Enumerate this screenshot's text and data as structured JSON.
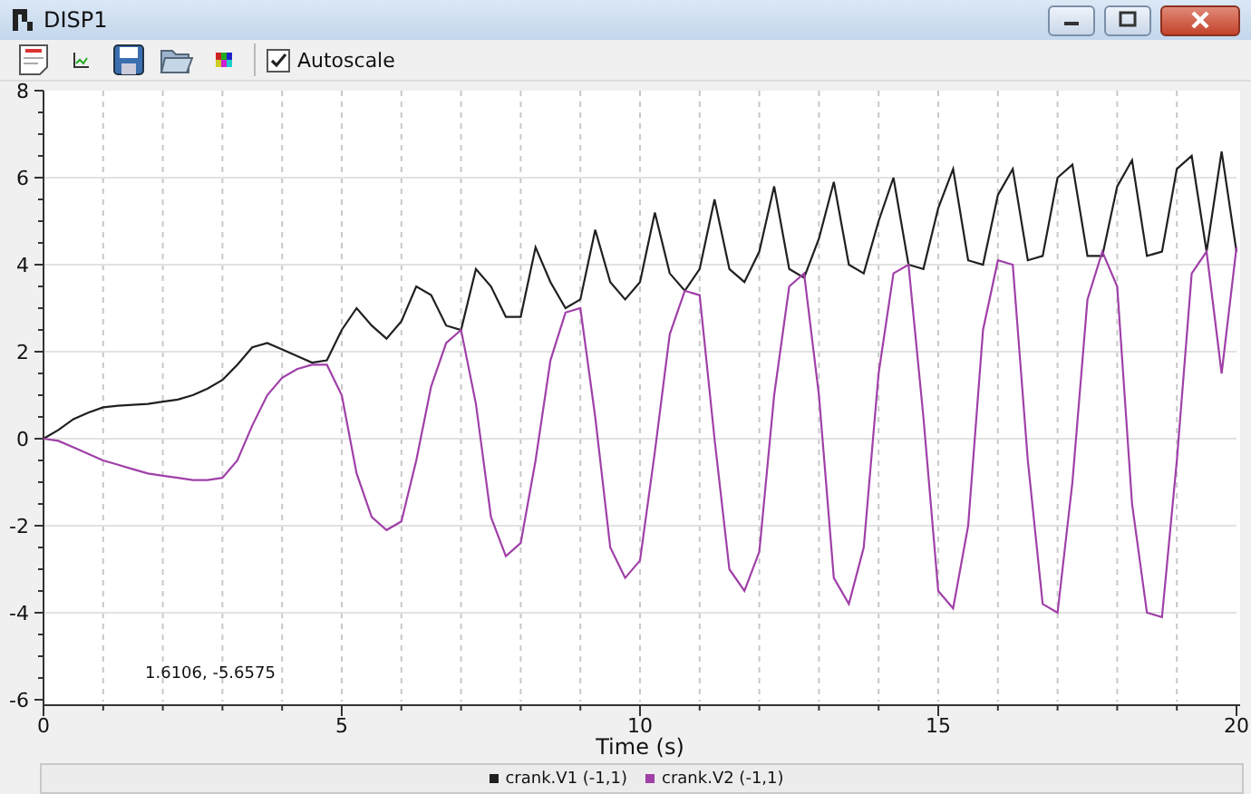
{
  "window": {
    "title": "DISP1"
  },
  "toolbar": {
    "tools": [
      {
        "kind": "note"
      },
      {
        "kind": "axes"
      },
      {
        "kind": "save"
      },
      {
        "kind": "open"
      },
      {
        "kind": "colors"
      }
    ],
    "autoscale": {
      "label": "Autoscale",
      "checked": true
    }
  },
  "plot": {
    "readout": "1.6106, -5.6575",
    "chart_data": {
      "type": "line",
      "grid": true,
      "xlabel": "Time (s)",
      "xlim": [
        0,
        20
      ],
      "ylim": [
        -6,
        8
      ],
      "xticks": [
        0,
        5,
        10,
        15,
        20
      ],
      "yticks": [
        -6,
        -4,
        -2,
        0,
        2,
        4,
        6,
        8
      ],
      "x": [
        0,
        0.25,
        0.5,
        0.75,
        1,
        1.25,
        1.5,
        1.75,
        2,
        2.25,
        2.5,
        2.75,
        3,
        3.25,
        3.5,
        3.75,
        4,
        4.25,
        4.5,
        4.75,
        5,
        5.25,
        5.5,
        5.75,
        6,
        6.25,
        6.5,
        6.75,
        7,
        7.25,
        7.5,
        7.75,
        8,
        8.25,
        8.5,
        8.75,
        9,
        9.25,
        9.5,
        9.75,
        10,
        10.25,
        10.5,
        10.75,
        11,
        11.25,
        11.5,
        11.75,
        12,
        12.25,
        12.5,
        12.75,
        13,
        13.25,
        13.5,
        13.75,
        14,
        14.25,
        14.5,
        14.75,
        15,
        15.25,
        15.5,
        15.75,
        16,
        16.25,
        16.5,
        16.75,
        17,
        17.25,
        17.5,
        17.75,
        18,
        18.25,
        18.5,
        18.75,
        19,
        19.25,
        19.5,
        19.75,
        20
      ],
      "series": [
        {
          "name": "crank.V1 (-1,1)",
          "color": "#202020",
          "values": [
            0,
            0.2,
            0.45,
            0.6,
            0.72,
            0.76,
            0.78,
            0.8,
            0.85,
            0.9,
            1.0,
            1.15,
            1.35,
            1.7,
            2.1,
            2.2,
            2.05,
            1.9,
            1.75,
            1.8,
            2.5,
            3.0,
            2.6,
            2.3,
            2.7,
            3.5,
            3.3,
            2.6,
            2.5,
            3.9,
            3.5,
            2.8,
            2.8,
            4.4,
            3.6,
            3.0,
            3.2,
            4.8,
            3.6,
            3.2,
            3.6,
            5.2,
            3.8,
            3.4,
            3.9,
            5.5,
            3.9,
            3.6,
            4.3,
            5.8,
            3.9,
            3.7,
            4.6,
            5.9,
            4.0,
            3.8,
            5.0,
            6.0,
            4.0,
            3.9,
            5.3,
            6.2,
            4.1,
            4.0,
            5.6,
            6.2,
            4.1,
            4.2,
            6.0,
            6.3,
            4.2,
            4.2,
            5.8,
            6.4,
            4.2,
            4.3,
            6.2,
            6.5,
            4.3,
            6.6,
            4.3
          ]
        },
        {
          "name": "crank.V2 (-1,1)",
          "color": "#a040a8",
          "values": [
            0,
            -0.05,
            -0.2,
            -0.35,
            -0.5,
            -0.6,
            -0.7,
            -0.8,
            -0.85,
            -0.9,
            -0.95,
            -0.95,
            -0.9,
            -0.5,
            0.3,
            1.0,
            1.4,
            1.6,
            1.7,
            1.7,
            1.0,
            -0.8,
            -1.8,
            -2.1,
            -1.9,
            -0.5,
            1.2,
            2.2,
            2.5,
            0.8,
            -1.8,
            -2.7,
            -2.4,
            -0.5,
            1.8,
            2.9,
            3.0,
            0.5,
            -2.5,
            -3.2,
            -2.8,
            -0.3,
            2.4,
            3.4,
            3.3,
            0,
            -3.0,
            -3.5,
            -2.6,
            1.0,
            3.5,
            3.8,
            1.0,
            -3.2,
            -3.8,
            -2.5,
            1.5,
            3.8,
            4.0,
            0.5,
            -3.5,
            -3.9,
            -2.0,
            2.5,
            4.1,
            4.0,
            -0.5,
            -3.8,
            -4.0,
            -1.0,
            3.2,
            4.3,
            3.5,
            -1.5,
            -4.0,
            -4.1,
            -0.5,
            3.8,
            4.3,
            1.5,
            4.4
          ]
        }
      ]
    }
  }
}
